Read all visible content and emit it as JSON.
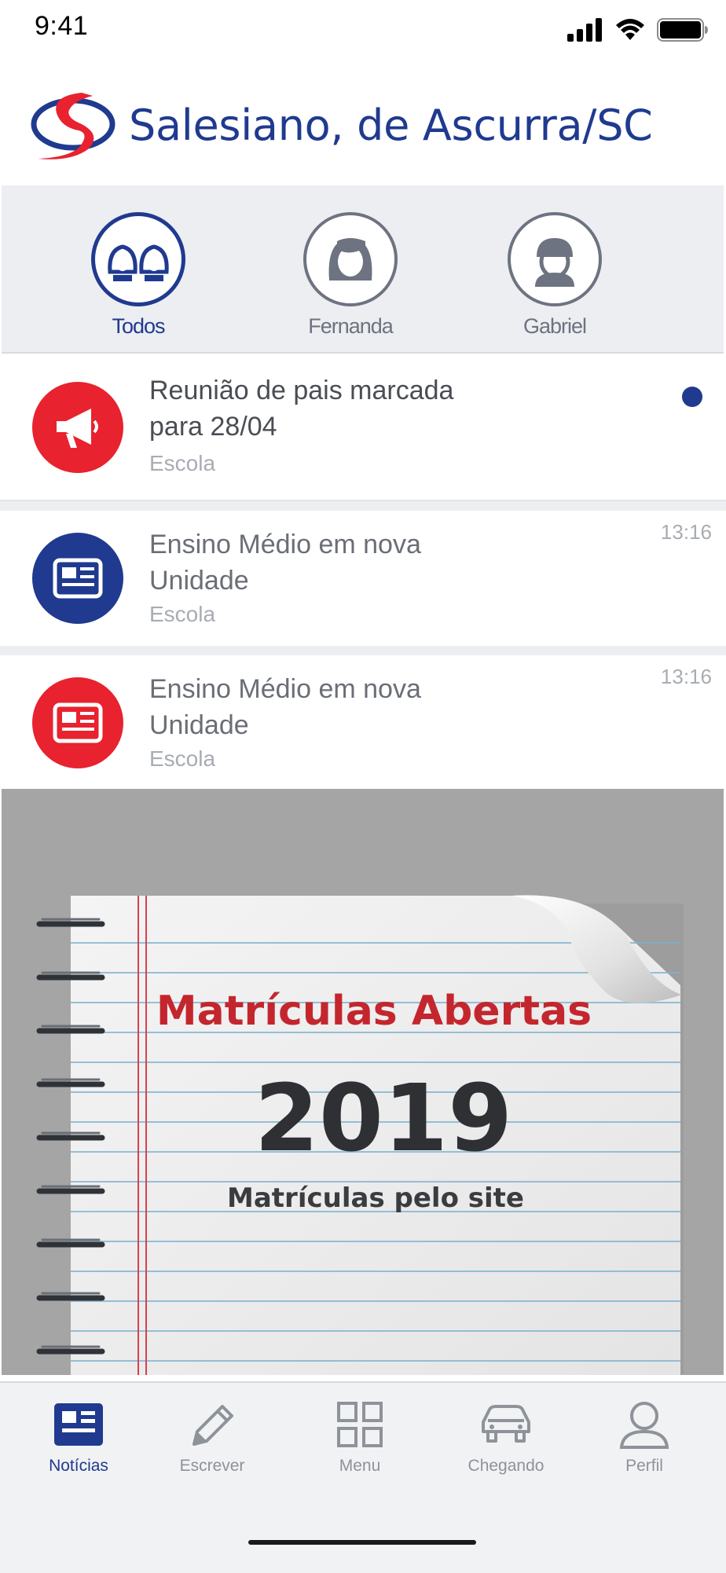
{
  "status_bar": {
    "time": "9:41"
  },
  "header": {
    "title": "Salesiano, de Ascurra/SC"
  },
  "profiles": [
    {
      "label": "Todos",
      "selected": true
    },
    {
      "label": "Fernanda",
      "selected": false
    },
    {
      "label": "Gabriel",
      "selected": false
    }
  ],
  "news": [
    {
      "title_line1": "Reunião de pais marcada",
      "title_line2": "para 28/04",
      "source": "Escola",
      "time": "",
      "unread": true,
      "icon": "megaphone-icon",
      "icon_color": "#e8222e"
    },
    {
      "title_line1": "Ensino Médio em nova",
      "title_line2": "Unidade",
      "source": "Escola",
      "time": "13:16",
      "unread": false,
      "icon": "newspaper-icon",
      "icon_color": "#1f3a8f"
    },
    {
      "title_line1": "Ensino Médio em nova",
      "title_line2": "Unidade",
      "source": "Escola",
      "time": "13:16",
      "unread": false,
      "icon": "newspaper-icon",
      "icon_color": "#e8222e"
    }
  ],
  "banner": {
    "headline": "Matrículas Abertas",
    "year": "2019",
    "subline": "Matrículas pelo site"
  },
  "tabs": [
    {
      "label": "Notícias",
      "icon": "newspaper-icon",
      "active": true
    },
    {
      "label": "Escrever",
      "icon": "pencil-icon",
      "active": false
    },
    {
      "label": "Menu",
      "icon": "grid-icon",
      "active": false
    },
    {
      "label": "Chegando",
      "icon": "car-icon",
      "active": false
    },
    {
      "label": "Perfil",
      "icon": "person-icon",
      "active": false
    }
  ],
  "colors": {
    "brand_blue": "#1f3a8f",
    "brand_red": "#e8222e",
    "inactive_gray": "#8e9299"
  }
}
